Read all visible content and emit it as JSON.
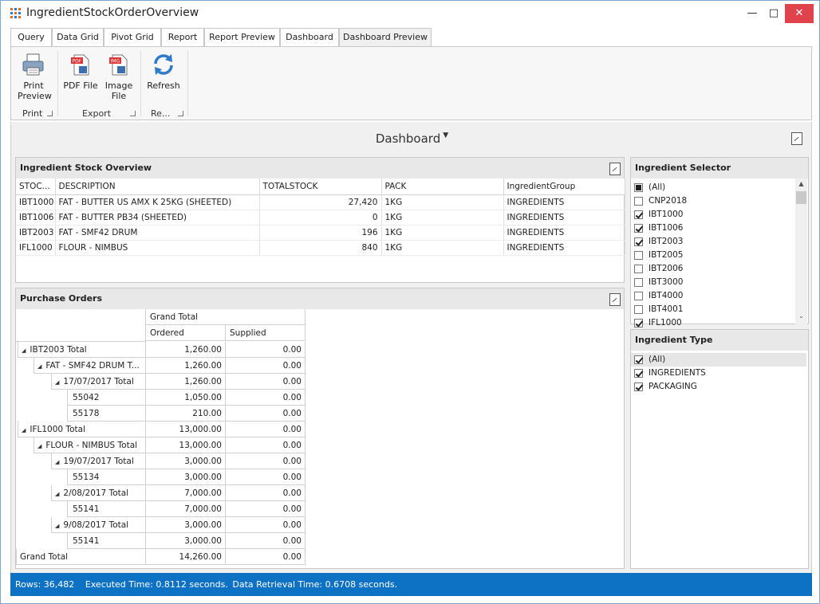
{
  "window": {
    "title": "IngredientStockOrderOverview"
  },
  "tabs": [
    "Query",
    "Data Grid",
    "Pivot Grid",
    "Report",
    "Report Preview",
    "Dashboard",
    "Dashboard Preview"
  ],
  "ribbon": {
    "print_preview": "Print Preview",
    "pdf_file": "PDF File",
    "image_file": "Image File",
    "refresh": "Refresh",
    "group_print": "Print",
    "group_export": "Export",
    "group_refresh": "Re..."
  },
  "dashboard": {
    "title": "Dashboard"
  },
  "stock_overview": {
    "title": "Ingredient Stock Overview",
    "columns": [
      "STOC...",
      "DESCRIPTION",
      "TOTALSTOCK",
      "PACK",
      "IngredientGroup"
    ],
    "rows": [
      [
        "IBT1000",
        "FAT - BUTTER US AMX K 25KG (SHEETED)",
        "27,420",
        "1KG",
        "INGREDIENTS"
      ],
      [
        "IBT1006",
        "FAT - BUTTER PB34 (SHEETED)",
        "0",
        "1KG",
        "INGREDIENTS"
      ],
      [
        "IBT2003",
        "FAT - SMF42 DRUM",
        "196",
        "1KG",
        "INGREDIENTS"
      ],
      [
        "IFL1000",
        "FLOUR - NIMBUS",
        "840",
        "1KG",
        "INGREDIENTS"
      ]
    ]
  },
  "purchase_orders": {
    "title": "Purchase Orders",
    "grand_total_label": "Grand Total",
    "ordered_label": "Ordered",
    "supplied_label": "Supplied",
    "rows": [
      {
        "label": "IBT2003 Total",
        "level": 0,
        "expander": true,
        "ordered": "1,260.00",
        "supplied": "0.00"
      },
      {
        "label": "FAT - SMF42 DRUM T...",
        "level": 1,
        "expander": true,
        "ordered": "1,260.00",
        "supplied": "0.00"
      },
      {
        "label": "17/07/2017 Total",
        "level": 2,
        "expander": true,
        "ordered": "1,260.00",
        "supplied": "0.00"
      },
      {
        "label": "55042",
        "level": 3,
        "expander": false,
        "ordered": "1,050.00",
        "supplied": "0.00"
      },
      {
        "label": "55178",
        "level": 3,
        "expander": false,
        "ordered": "210.00",
        "supplied": "0.00"
      },
      {
        "label": "IFL1000 Total",
        "level": 0,
        "expander": true,
        "ordered": "13,000.00",
        "supplied": "0.00"
      },
      {
        "label": "FLOUR - NIMBUS Total",
        "level": 1,
        "expander": true,
        "ordered": "13,000.00",
        "supplied": "0.00"
      },
      {
        "label": "19/07/2017 Total",
        "level": 2,
        "expander": true,
        "ordered": "3,000.00",
        "supplied": "0.00"
      },
      {
        "label": "55134",
        "level": 3,
        "expander": false,
        "ordered": "3,000.00",
        "supplied": "0.00"
      },
      {
        "label": "2/08/2017 Total",
        "level": 2,
        "expander": true,
        "ordered": "7,000.00",
        "supplied": "0.00"
      },
      {
        "label": "55141",
        "level": 3,
        "expander": false,
        "ordered": "7,000.00",
        "supplied": "0.00"
      },
      {
        "label": "9/08/2017 Total",
        "level": 2,
        "expander": true,
        "ordered": "3,000.00",
        "supplied": "0.00"
      },
      {
        "label": "55141",
        "level": 3,
        "expander": false,
        "ordered": "3,000.00",
        "supplied": "0.00"
      },
      {
        "label": "Grand Total",
        "level": -1,
        "expander": false,
        "ordered": "14,260.00",
        "supplied": "0.00"
      }
    ]
  },
  "ingredient_selector": {
    "title": "Ingredient Selector",
    "items": [
      {
        "label": "(All)",
        "state": "mixed"
      },
      {
        "label": "CNP2018",
        "state": "off"
      },
      {
        "label": "IBT1000",
        "state": "on"
      },
      {
        "label": "IBT1006",
        "state": "on"
      },
      {
        "label": "IBT2003",
        "state": "on"
      },
      {
        "label": "IBT2005",
        "state": "off"
      },
      {
        "label": "IBT2006",
        "state": "off"
      },
      {
        "label": "IBT3000",
        "state": "off"
      },
      {
        "label": "IBT4000",
        "state": "off"
      },
      {
        "label": "IBT4001",
        "state": "off"
      },
      {
        "label": "IFL1000",
        "state": "on"
      }
    ]
  },
  "ingredient_type": {
    "title": "Ingredient Type",
    "items": [
      {
        "label": "(All)",
        "state": "on"
      },
      {
        "label": "INGREDIENTS",
        "state": "on"
      },
      {
        "label": "PACKAGING",
        "state": "on"
      }
    ]
  },
  "status": {
    "rows": "Rows: 36,482",
    "executed": "Executed Time: 0.8112 seconds.",
    "retrieval": "Data Retrieval Time: 0.6708 seconds."
  },
  "colors": {
    "accent": "#0e72c4",
    "close": "#e0434b",
    "panel_header": "#e8e8e8"
  }
}
